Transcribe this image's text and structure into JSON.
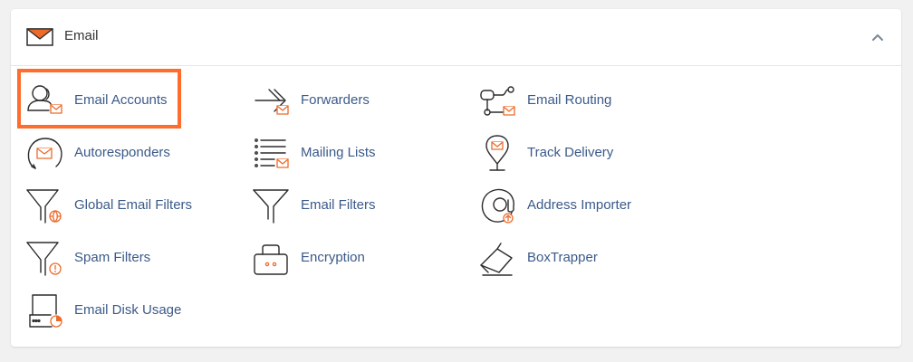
{
  "section": {
    "title": "Email",
    "icon": "envelope-icon",
    "collapse_icon": "chevron-up-icon",
    "accent_color": "#ee6a2a",
    "highlight_color": "#ff6c2c"
  },
  "tools": [
    {
      "label": "Email Accounts",
      "icon": "user-email-icon",
      "highlighted": true
    },
    {
      "label": "Forwarders",
      "icon": "forward-arrow-icon"
    },
    {
      "label": "Email Routing",
      "icon": "routing-icon"
    },
    {
      "label": "Autoresponders",
      "icon": "autoresponder-icon"
    },
    {
      "label": "Mailing Lists",
      "icon": "mailing-list-icon"
    },
    {
      "label": "Track Delivery",
      "icon": "location-pin-icon"
    },
    {
      "label": "Global Email Filters",
      "icon": "filter-globe-icon"
    },
    {
      "label": "Email Filters",
      "icon": "filter-icon"
    },
    {
      "label": "Address Importer",
      "icon": "at-sign-icon"
    },
    {
      "label": "Spam Filters",
      "icon": "spam-filter-icon"
    },
    {
      "label": "Encryption",
      "icon": "encryption-icon"
    },
    {
      "label": "BoxTrapper",
      "icon": "boxtrapper-icon"
    },
    {
      "label": "Email Disk Usage",
      "icon": "disk-usage-icon"
    }
  ]
}
